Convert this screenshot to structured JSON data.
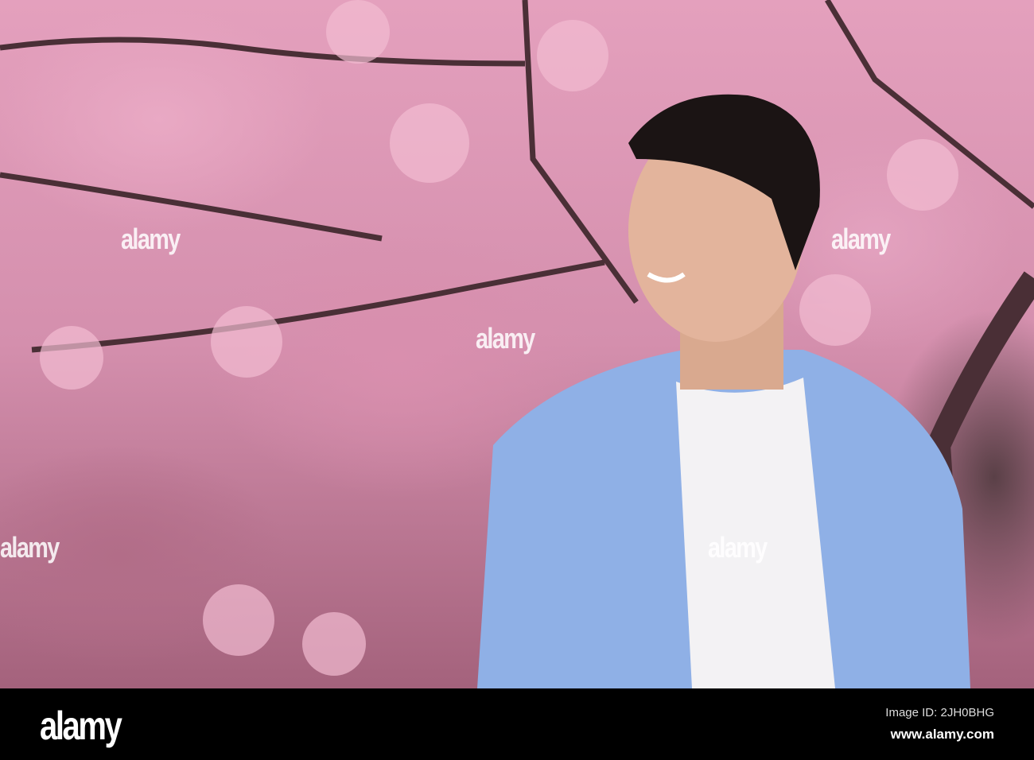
{
  "watermark": "alamy",
  "footer": {
    "logo": "alamy",
    "image_id": "Image ID: 2JH0BHG",
    "website": "www.alamy.com"
  }
}
